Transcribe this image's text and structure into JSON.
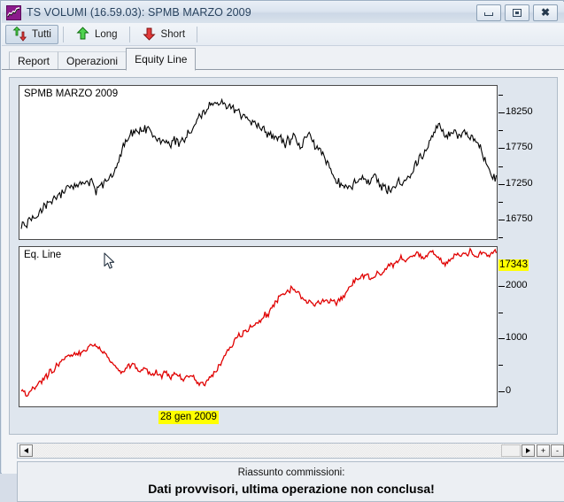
{
  "window": {
    "title": "TS VOLUMI (16.59.03): SPMB MARZO 2009",
    "icon": "chart-line-icon",
    "buttons": {
      "minimize": "minimize-icon",
      "maximize": "maximize-icon",
      "close": "close-icon"
    }
  },
  "toolbar": {
    "items": [
      {
        "label": "Tutti",
        "icon": "up-down-arrow-icon",
        "pressed": true
      },
      {
        "label": "Long",
        "icon": "green-up-arrow-icon",
        "pressed": false
      },
      {
        "label": "Short",
        "icon": "red-down-arrow-icon",
        "pressed": false
      }
    ]
  },
  "tabs": [
    {
      "label": "Report",
      "active": false
    },
    {
      "label": "Operazioni",
      "active": false
    },
    {
      "label": "Equity Line",
      "active": true
    }
  ],
  "charts": {
    "price": {
      "label": "SPMB MARZO 2009",
      "current_value_badge": "17343",
      "axis_ticks": [
        "18250",
        "17750",
        "17250",
        "16750"
      ]
    },
    "equity": {
      "label": "Eq. Line",
      "axis_ticks": [
        "2000",
        "1000",
        "0"
      ]
    },
    "date_badge": "28 gen 2009"
  },
  "scrollbar": {
    "left_arrow": "scroll-left-icon",
    "right_arrow": "scroll-right-icon",
    "zoom_in": "+",
    "zoom_out": "-"
  },
  "footer": {
    "line1": "Riassunto commissioni:",
    "line2": "Dati provvisori, ultima operazione non conclusa!"
  },
  "colors": {
    "price_line": "#000000",
    "equity_line": "#e00000",
    "highlight": "#ffff00",
    "title_text": "#28425e"
  },
  "chart_data": [
    {
      "type": "line",
      "title": "SPMB MARZO 2009",
      "xlabel": "",
      "ylabel": "",
      "ylim": [
        16500,
        18600
      ],
      "yticks": [
        16750,
        17250,
        17750,
        18250
      ],
      "grid": false,
      "legend": null,
      "annotations": [
        {
          "text": "17343",
          "kind": "last-price-badge",
          "color": "#ffff00"
        },
        {
          "text": "28 gen 2009",
          "kind": "x-axis-date-badge",
          "color": "#ffff00"
        }
      ],
      "series": [
        {
          "name": "SPMB MARZO 2009",
          "color": "#000000",
          "values": [
            16680,
            16700,
            16655,
            16610,
            16720,
            16760,
            16700,
            16745,
            16790,
            16760,
            16820,
            16880,
            16850,
            16900,
            16940,
            16900,
            16960,
            17000,
            16960,
            17020,
            17060,
            17010,
            17080,
            17120,
            17080,
            17140,
            17100,
            17160,
            17200,
            17160,
            17220,
            17180,
            17240,
            17200,
            17250,
            17210,
            17270,
            17230,
            17280,
            17240,
            17290,
            17250,
            17300,
            17260,
            17180,
            17100,
            17160,
            17220,
            17260,
            17200,
            17280,
            17320,
            17270,
            17340,
            17400,
            17360,
            17430,
            17500,
            17560,
            17620,
            17690,
            17760,
            17830,
            17900,
            17860,
            17930,
            17990,
            17940,
            18010,
            17960,
            18020,
            17970,
            18030,
            17980,
            18040,
            17990,
            18050,
            18000,
            17960,
            17900,
            17940,
            17880,
            17830,
            17890,
            17840,
            17880,
            17830,
            17870,
            17820,
            17860,
            17800,
            17840,
            17880,
            17830,
            17870,
            17820,
            17860,
            17900,
            17860,
            17910,
            17950,
            18000,
            17960,
            18010,
            18060,
            18110,
            18160,
            18210,
            18180,
            18240,
            18290,
            18250,
            18310,
            18360,
            18320,
            18380,
            18340,
            18400,
            18360,
            18420,
            18380,
            18440,
            18400,
            18350,
            18300,
            18360,
            18310,
            18370,
            18320,
            18280,
            18230,
            18290,
            18240,
            18190,
            18240,
            18190,
            18140,
            18190,
            18140,
            18090,
            18140,
            18090,
            18040,
            18090,
            18040,
            17990,
            18040,
            17990,
            17940,
            17990,
            17940,
            17890,
            17940,
            17890,
            17840,
            17890,
            17940,
            17890,
            17840,
            17790,
            17840,
            17890,
            17840,
            17890,
            17940,
            17890,
            17840,
            17790,
            17740,
            17790,
            17840,
            17890,
            17940,
            17990,
            17940,
            17890,
            17840,
            17790,
            17740,
            17690,
            17740,
            17690,
            17640,
            17590,
            17540,
            17490,
            17440,
            17390,
            17340,
            17290,
            17240,
            17290,
            17240,
            17190,
            17240,
            17190,
            17140,
            17190,
            17240,
            17190,
            17240,
            17290,
            17240,
            17290,
            17340,
            17290,
            17340,
            17290,
            17240,
            17290,
            17240,
            17290,
            17340,
            17390,
            17340,
            17290,
            17240,
            17190,
            17240,
            17190,
            17140,
            17190,
            17140,
            17190,
            17240,
            17190,
            17240,
            17290,
            17240,
            17190,
            17240,
            17290,
            17340,
            17290,
            17340,
            17390,
            17440,
            17490,
            17540,
            17590,
            17640,
            17600,
            17660,
            17710,
            17760,
            17810,
            17860,
            17910,
            17960,
            18010,
            18060,
            18110,
            18060,
            18010,
            17960,
            17910,
            17960,
            17910,
            17960,
            18010,
            17960,
            18010,
            17960,
            17910,
            17960,
            17910,
            17960,
            18010,
            17960,
            17910,
            17860,
            17910,
            17860,
            17810,
            17860,
            17810,
            17760,
            17710,
            17660,
            17610,
            17560,
            17510,
            17460,
            17410,
            17360,
            17310,
            17343
          ]
        }
      ]
    },
    {
      "type": "line",
      "title": "Eq. Line",
      "xlabel": "",
      "ylabel": "",
      "ylim": [
        -250,
        2700
      ],
      "yticks": [
        0,
        1000,
        2000
      ],
      "grid": false,
      "legend": null,
      "annotations": [],
      "series": [
        {
          "name": "Eq. Line",
          "color": "#e00000",
          "values": [
            40,
            10,
            -60,
            -120,
            -40,
            30,
            90,
            20,
            110,
            180,
            140,
            220,
            290,
            250,
            330,
            400,
            360,
            440,
            510,
            470,
            550,
            620,
            580,
            660,
            730,
            690,
            640,
            700,
            760,
            720,
            680,
            740,
            800,
            760,
            820,
            880,
            840,
            900,
            860,
            820,
            780,
            740,
            700,
            650,
            600,
            560,
            520,
            480,
            440,
            400,
            360,
            330,
            380,
            440,
            500,
            460,
            520,
            480,
            430,
            390,
            350,
            400,
            460,
            420,
            380,
            340,
            300,
            340,
            390,
            350,
            310,
            280,
            320,
            370,
            330,
            290,
            250,
            300,
            350,
            310,
            270,
            230,
            190,
            240,
            290,
            250,
            300,
            260,
            220,
            180,
            140,
            190,
            150,
            110,
            160,
            210,
            260,
            310,
            360,
            420,
            480,
            540,
            600,
            660,
            720,
            780,
            840,
            900,
            960,
            1020,
            1080,
            1040,
            1100,
            1160,
            1120,
            1180,
            1240,
            1200,
            1260,
            1320,
            1280,
            1340,
            1400,
            1460,
            1420,
            1480,
            1540,
            1600,
            1660,
            1720,
            1780,
            1840,
            1800,
            1860,
            1920,
            1880,
            1940,
            2000,
            1960,
            1900,
            1860,
            1820,
            1780,
            1740,
            1700,
            1660,
            1700,
            1660,
            1620,
            1660,
            1700,
            1660,
            1700,
            1740,
            1700,
            1660,
            1700,
            1740,
            1700,
            1660,
            1700,
            1740,
            1780,
            1820,
            1860,
            1900,
            1960,
            2020,
            2080,
            2140,
            2100,
            2160,
            2220,
            2180,
            2240,
            2200,
            2160,
            2120,
            2160,
            2200,
            2240,
            2200,
            2240,
            2280,
            2320,
            2360,
            2400,
            2440,
            2400,
            2440,
            2480,
            2520,
            2560,
            2520,
            2480,
            2520,
            2560,
            2600,
            2560,
            2600,
            2640,
            2600,
            2560,
            2520,
            2560,
            2600,
            2640,
            2680,
            2640,
            2600,
            2560,
            2520,
            2480,
            2440,
            2400,
            2440,
            2480,
            2520,
            2560,
            2600,
            2640,
            2600,
            2560,
            2600,
            2640,
            2600,
            2640,
            2680,
            2640,
            2600,
            2560,
            2600,
            2640,
            2680,
            2640,
            2600,
            2560,
            2600,
            2640,
            2680,
            2620
          ]
        }
      ]
    }
  ]
}
